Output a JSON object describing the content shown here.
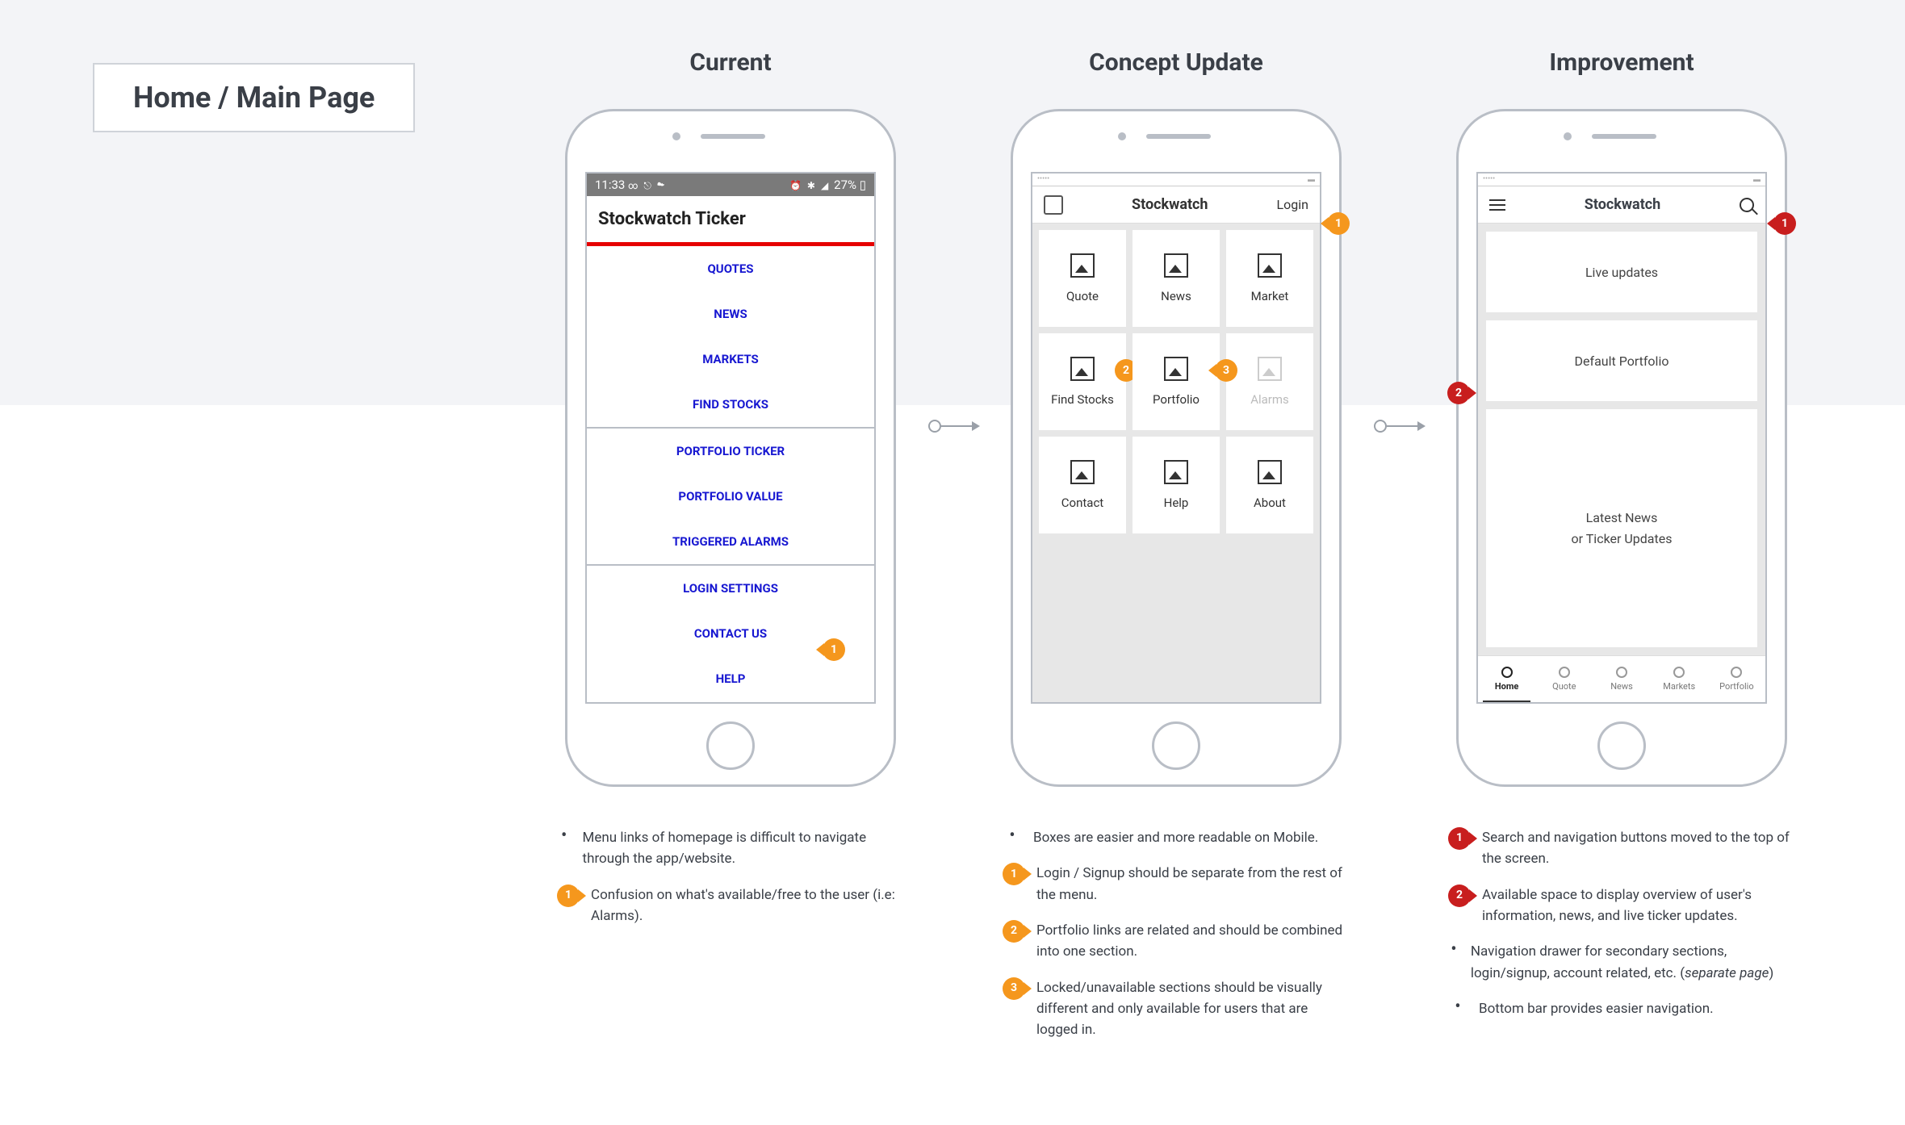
{
  "page_title": "Home / Main Page",
  "columns": {
    "current": {
      "title": "Current"
    },
    "concept": {
      "title": "Concept Update"
    },
    "improvement": {
      "title": "Improvement"
    }
  },
  "current_phone": {
    "status_time": "11:33",
    "status_right": "27%",
    "app_title": "Stockwatch Ticker",
    "items_group1": [
      "QUOTES",
      "NEWS",
      "MARKETS",
      "FIND STOCKS"
    ],
    "items_group2": [
      "PORTFOLIO TICKER",
      "PORTFOLIO VALUE",
      "TRIGGERED ALARMS"
    ],
    "items_group3": [
      "LOGIN SETTINGS",
      "CONTACT US",
      "HELP"
    ],
    "badge1": "1"
  },
  "concept_phone": {
    "header_title": "Stockwatch",
    "login_label": "Login",
    "cards": [
      {
        "label": "Quote",
        "disabled": false
      },
      {
        "label": "News",
        "disabled": false
      },
      {
        "label": "Market",
        "disabled": false
      },
      {
        "label": "Find Stocks",
        "disabled": false
      },
      {
        "label": "Portfolio",
        "disabled": false
      },
      {
        "label": "Alarms",
        "disabled": true
      },
      {
        "label": "Contact",
        "disabled": false
      },
      {
        "label": "Help",
        "disabled": false
      },
      {
        "label": "About",
        "disabled": false
      }
    ],
    "badges": {
      "login": "1",
      "portfolio": "2",
      "alarms": "3"
    }
  },
  "improvement_phone": {
    "header_title": "Stockwatch",
    "card1": "Live updates",
    "card2": "Default Portfolio",
    "card3_line1": "Latest News",
    "card3_line2": "or Ticker Updates",
    "tabs": [
      "Home",
      "Quote",
      "News",
      "Markets",
      "Portfolio"
    ],
    "badges": {
      "search": "1",
      "side": "2"
    }
  },
  "notes": {
    "current": [
      {
        "type": "bullet",
        "text": "Menu links of homepage is difficult to navigate through the app/website."
      },
      {
        "type": "badge",
        "num": "1",
        "color": "orange",
        "text": "Confusion on what's available/free to the user (i.e: Alarms)."
      }
    ],
    "concept": [
      {
        "type": "bullet",
        "text": "Boxes are easier and more readable on Mobile."
      },
      {
        "type": "badge",
        "num": "1",
        "color": "orange",
        "text": "Login / Signup should be separate from the rest of the menu."
      },
      {
        "type": "badge",
        "num": "2",
        "color": "orange",
        "text": "Portfolio links are related and should be combined into one section."
      },
      {
        "type": "badge",
        "num": "3",
        "color": "orange",
        "text": "Locked/unavailable sections should be visually different and only available for users that are logged in."
      }
    ],
    "improvement": [
      {
        "type": "badge",
        "num": "1",
        "color": "red",
        "text": "Search and navigation buttons moved to the top of the screen."
      },
      {
        "type": "badge",
        "num": "2",
        "color": "red",
        "text": "Available space to display overview of user's information, news, and live ticker updates."
      },
      {
        "type": "bullet",
        "text": "Navigation drawer for secondary sections, login/signup, account related, etc. (<i>separate page</i>)"
      },
      {
        "type": "bullet",
        "text": "Bottom bar provides easier navigation."
      }
    ]
  }
}
